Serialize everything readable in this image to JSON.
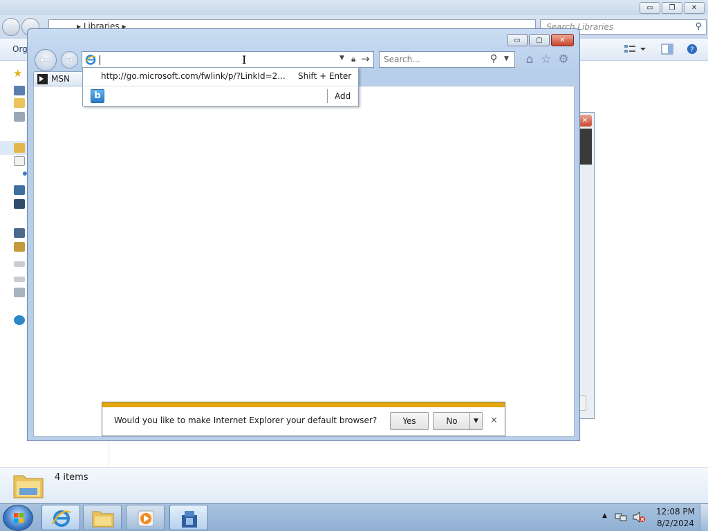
{
  "explorer": {
    "address_text": "▸ Libraries ▸",
    "search_placeholder": "Search Libraries",
    "organize_label": "Org",
    "status_items": "4 items",
    "minimize_glyph": "▭",
    "restore_glyph": "❐",
    "close_glyph": "✕"
  },
  "ie": {
    "minimize_glyph": "▭",
    "maximize_glyph": "▢",
    "close_glyph": "✕",
    "back_glyph": "←",
    "forward_glyph": "→",
    "address_value": "",
    "search_placeholder": "Search...",
    "tab_label": "MSN",
    "home_icon": "⌂",
    "favorites_icon": "☆",
    "tools_icon": "⚙",
    "autocomplete": {
      "suggestion_url": "http://go.microsoft.com/fwlink/p/?LinkId=2...",
      "suggestion_shortcut": "Shift + Enter",
      "provider_glyph": "b",
      "add_label": "Add"
    },
    "notification": {
      "message": "Would you like to make Internet Explorer your default browser?",
      "yes_label": "Yes",
      "no_label": "No",
      "dropdown_glyph": "▼",
      "close_glyph": "✕"
    }
  },
  "taskbar": {
    "time": "12:08 PM",
    "date": "8/2/2024",
    "tray_expand_glyph": "▲"
  },
  "colors": {
    "notification_accent": "#e5a80a",
    "ie_frame": "#b8cfea",
    "taskbar": "#9ab8da"
  }
}
